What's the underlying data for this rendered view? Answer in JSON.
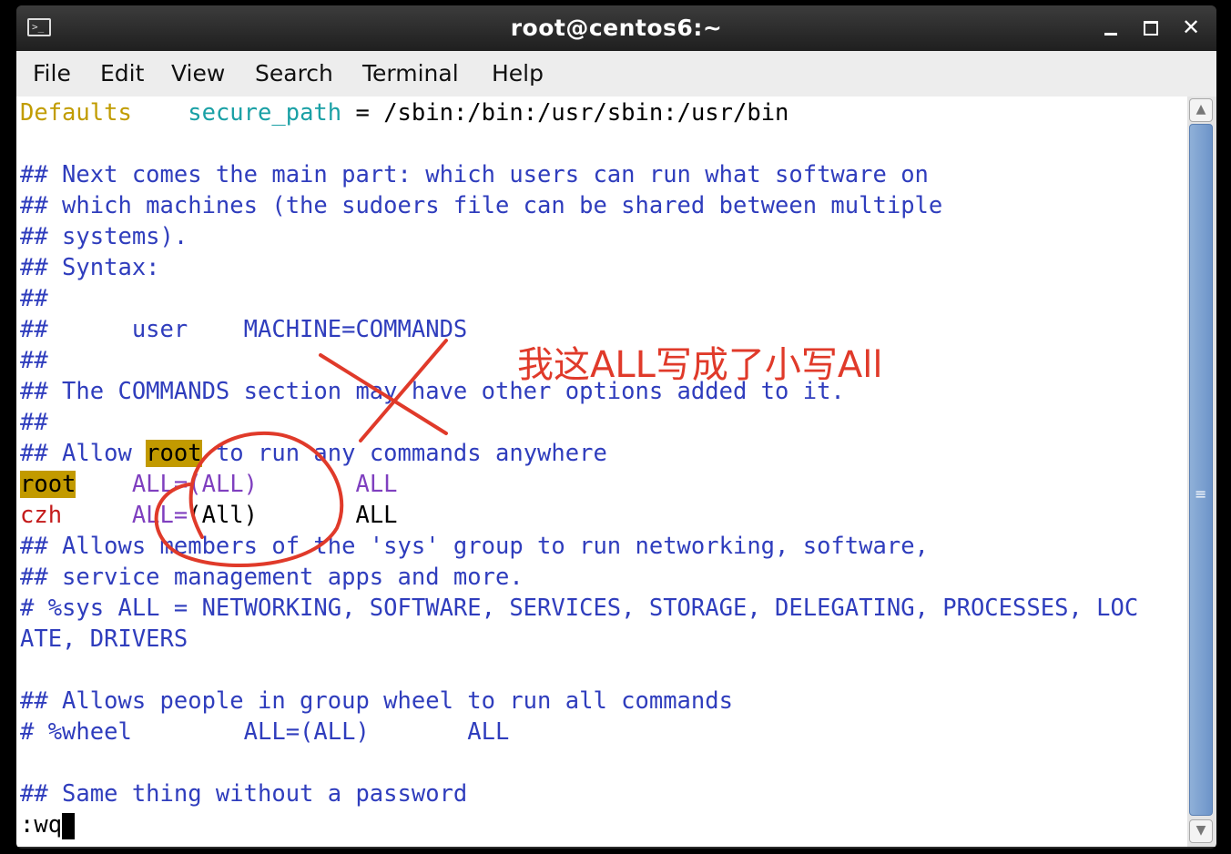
{
  "window": {
    "title": "root@centos6:~"
  },
  "menu": [
    "File",
    "Edit",
    "View",
    "Search",
    "Terminal",
    "Help"
  ],
  "terminal": {
    "defaults_kw": "Defaults",
    "secure_path_kw": "secure_path",
    "secure_path_rest": " = /sbin:/bin:/usr/sbin:/usr/bin",
    "c1": "## Next comes the main part: which users can run what software on",
    "c2": "## which machines (the sudoers file can be shared between multiple",
    "c3": "## systems).",
    "c4": "## Syntax:",
    "c5": "##",
    "c6": "##      user    MACHINE=COMMANDS",
    "c7": "##",
    "c8": "## The COMMANDS section may have other options added to it.",
    "c9": "##",
    "c10_a": "## Allow ",
    "c10_hl": "root",
    "c10_b": " to run any commands anywhere",
    "root_user": "root",
    "root_spec": "    ALL=(ALL)       ",
    "root_cmd": "ALL",
    "czh_user": "czh",
    "czh_spec_a": "     ALL=",
    "czh_spec_b": "(All)",
    "czh_cmd": "       ALL",
    "c11": "## Allows members of the 'sys' group to run networking, software,",
    "c12": "## service management apps and more.",
    "c13": "# %sys ALL = NETWORKING, SOFTWARE, SERVICES, STORAGE, DELEGATING, PROCESSES, LOC",
    "c14": "ATE, DRIVERS",
    "c15": "## Allows people in group wheel to run all commands",
    "c16": "# %wheel        ALL=(ALL)       ALL",
    "c17": "## Same thing without a password",
    "cmdline": ":wq"
  },
  "annotation": {
    "text": "我这ALL写成了小写All",
    "color": "#e03a2a"
  },
  "colors": {
    "comment": "#2f3dbd",
    "keyword": "#c19c00",
    "identifier": "#1aa0a5",
    "user": "#c41b1b",
    "spec": "#7f3fbf",
    "highlight": "#c29a00"
  },
  "icons": {
    "terminal": "terminal-icon",
    "minimize": "minimize-icon",
    "maximize": "maximize-icon",
    "close": "close-icon",
    "scroll_up": "chevron-up-icon",
    "scroll_down": "chevron-down-icon",
    "grip": "grip-icon"
  }
}
